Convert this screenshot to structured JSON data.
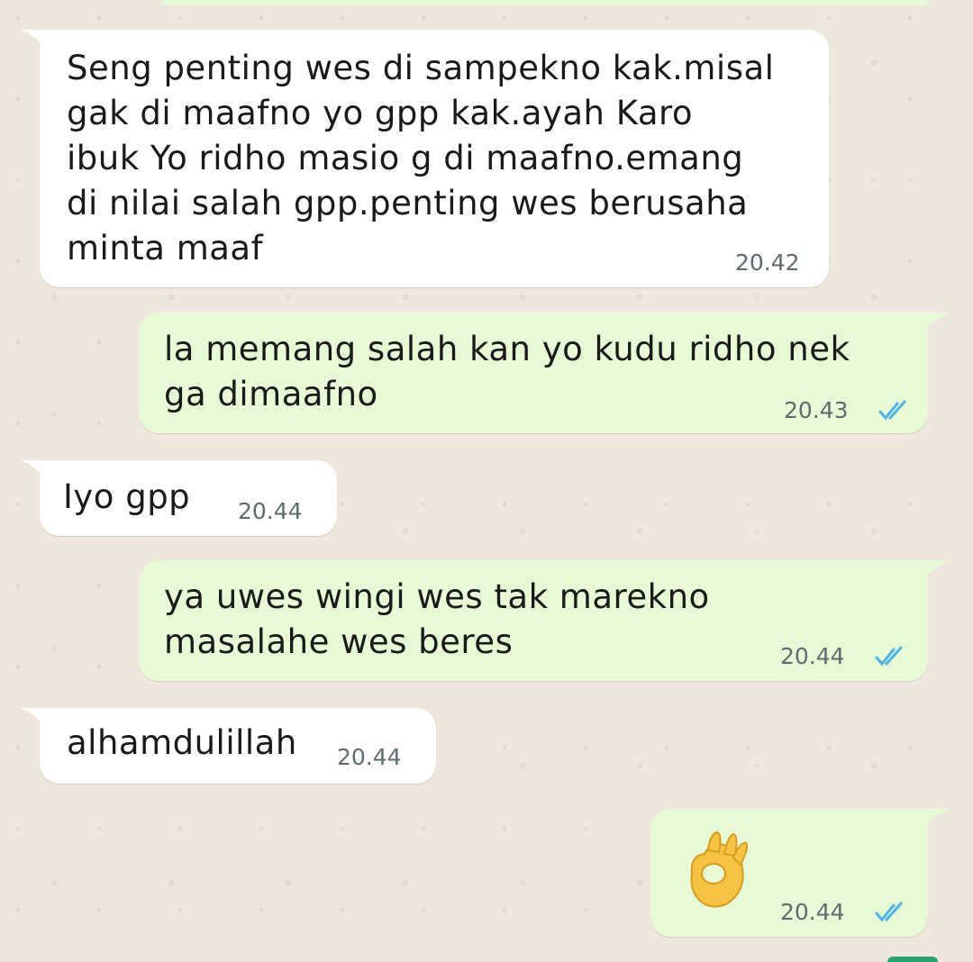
{
  "chat": {
    "messages": [
      {
        "direction": "incoming",
        "text": "Seng penting wes di sampekno kak.misal gak di maafno yo gpp kak.ayah Karo ibuk Yo ridho masio g di maafno.emang di nilai salah gpp.penting wes berusaha minta maaf",
        "lines": [
          "Seng penting wes di sampekno kak.misal",
          "gak di maafno yo gpp kak.ayah Karo",
          "ibuk Yo ridho masio g di maafno.emang",
          "di nilai salah gpp.penting wes berusaha",
          "minta maaf"
        ],
        "time": "20.42"
      },
      {
        "direction": "outgoing",
        "text": "la memang salah kan yo kudu ridho nek ga dimaafno",
        "lines": [
          "la memang salah kan yo kudu ridho nek",
          "ga dimaafno"
        ],
        "time": "20.43",
        "status": "read"
      },
      {
        "direction": "incoming",
        "text": "Iyo gpp",
        "lines": [
          "Iyo gpp"
        ],
        "time": "20.44"
      },
      {
        "direction": "outgoing",
        "text": "ya uwes wingi wes tak marekno masalahe wes beres",
        "lines": [
          "ya uwes wingi wes tak marekno",
          "masalahe wes beres"
        ],
        "time": "20.44",
        "status": "read"
      },
      {
        "direction": "incoming",
        "text": "alhamdulillah",
        "lines": [
          "alhamdulillah"
        ],
        "time": "20.44"
      },
      {
        "direction": "outgoing",
        "emoji": "ok-hand-emoji",
        "time": "20.44",
        "status": "read"
      }
    ]
  },
  "colors": {
    "wallpaper": "#efe7dd",
    "incoming_bubble": "#ffffff",
    "outgoing_bubble": "#e7fad5",
    "read_ticks": "#4fb3e8",
    "timestamp": "#5f6b6f",
    "emoji_skin": "#f6c343"
  }
}
